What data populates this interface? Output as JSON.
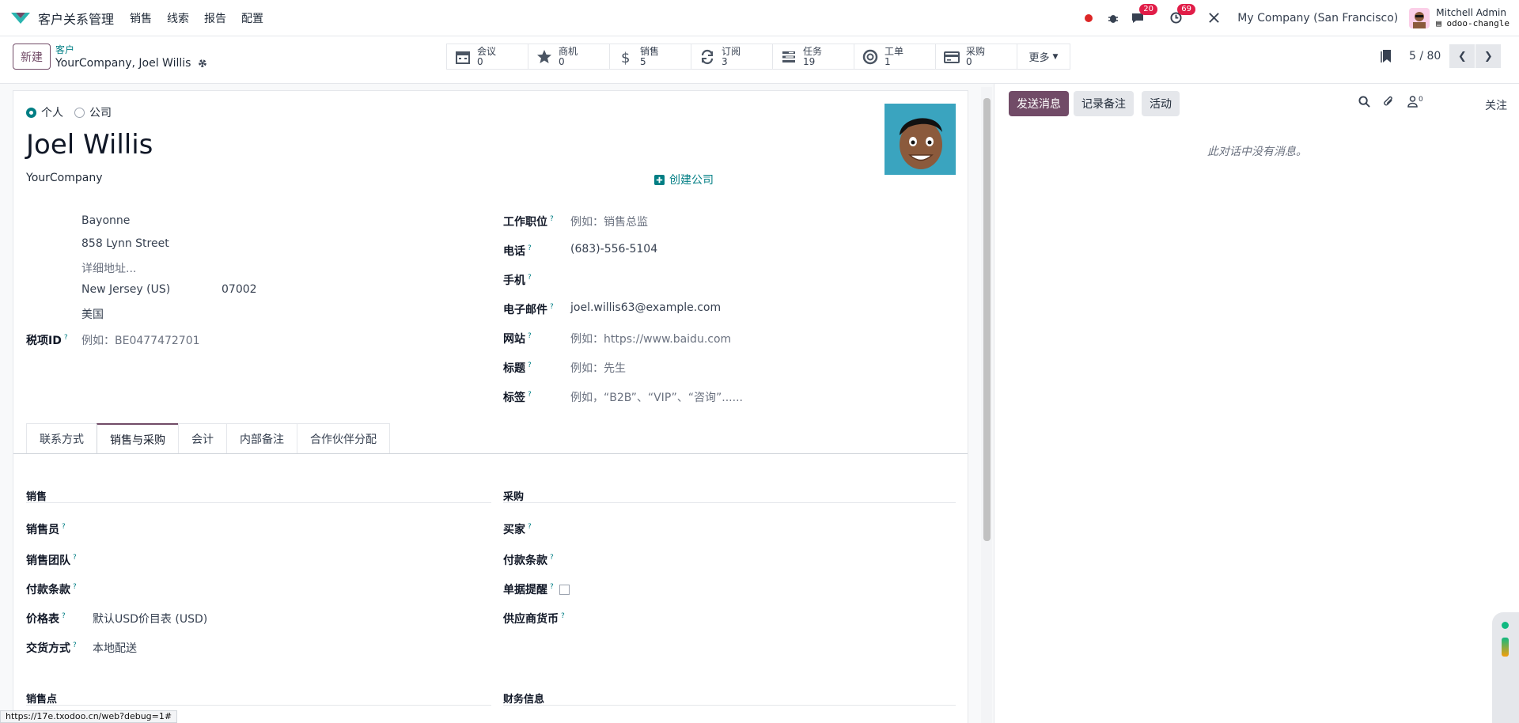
{
  "topbar": {
    "app_name": "客户关系管理",
    "menu": [
      "销售",
      "线索",
      "报告",
      "配置"
    ],
    "msg_badge": "20",
    "activity_badge": "69",
    "company": "My Company (San Francisco)",
    "user_name": "Mitchell Admin",
    "user_db": "odoo-changle"
  },
  "control": {
    "new_label": "新建",
    "breadcrumb_parent": "客户",
    "breadcrumb_current": "YourCompany, Joel Willis",
    "smart_buttons": [
      {
        "label": "会议",
        "value": "0",
        "icon": "calendar-icon"
      },
      {
        "label": "商机",
        "value": "0",
        "icon": "star-icon"
      },
      {
        "label": "销售",
        "value": "5",
        "icon": "dollar-icon"
      },
      {
        "label": "订阅",
        "value": "3",
        "icon": "refresh-icon"
      },
      {
        "label": "任务",
        "value": "19",
        "icon": "tasks-icon"
      },
      {
        "label": "工单",
        "value": "1",
        "icon": "lifebuoy-icon"
      },
      {
        "label": "采购",
        "value": "0",
        "icon": "credit-card-icon"
      }
    ],
    "more_label": "更多",
    "pager": "5 / 80"
  },
  "form": {
    "type_individual": "个人",
    "type_company": "公司",
    "name": "Joel Willis",
    "company_name": "YourCompany",
    "create_company": "创建公司",
    "address": {
      "city": "Bayonne",
      "street": "858 Lynn Street",
      "street2_placeholder": "详细地址...",
      "state": "New Jersey (US)",
      "zip": "07002",
      "country": "美国"
    },
    "tax_id_label": "税项ID",
    "tax_id_placeholder": "例如：BE0477472701",
    "job_label": "工作职位",
    "job_placeholder": "例如：销售总监",
    "phone_label": "电话",
    "phone": "(683)-556-5104",
    "mobile_label": "手机",
    "email_label": "电子邮件",
    "email": "joel.willis63@example.com",
    "website_label": "网站",
    "website_placeholder": "例如：https://www.baidu.com",
    "title_label": "标题",
    "title_placeholder": "例如：先生",
    "tags_label": "标签",
    "tags_placeholder": "例如，“B2B”、“VIP”、“咨询”......",
    "tabs": [
      "联系方式",
      "销售与采购",
      "会计",
      "内部备注",
      "合作伙伴分配"
    ],
    "sales_section": "销售",
    "salesperson_label": "销售员",
    "sales_team_label": "销售团队",
    "payment_terms_label": "付款条款",
    "pricelist_label": "价格表",
    "pricelist": "默认USD价目表 (USD)",
    "delivery_label": "交货方式",
    "delivery": "本地配送",
    "purchase_section": "采购",
    "buyer_label": "买家",
    "purchase_payment_terms_label": "付款条款",
    "receipt_reminder_label": "单据提醒",
    "vendor_currency_label": "供应商货币",
    "pos_section": "销售点",
    "fiscal_section": "财务信息"
  },
  "chatter": {
    "send_message": "发送消息",
    "log_note": "记录备注",
    "activity": "活动",
    "followers_count": "0",
    "follow": "关注",
    "empty": "此对话中没有消息。"
  },
  "status_url": "https://17e.txodoo.cn/web?debug=1#"
}
